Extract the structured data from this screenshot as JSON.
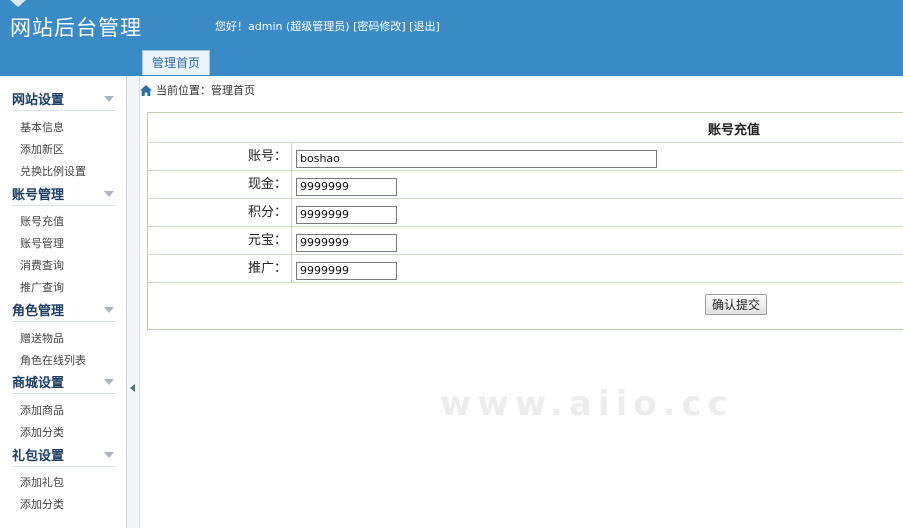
{
  "header": {
    "title": "网站后台管理",
    "greeting": "您好！",
    "username": "admin",
    "role": "(超级管理员)",
    "change_password": "[密码修改]",
    "logout": "[退出]"
  },
  "tabs": [
    {
      "label": "管理首页"
    }
  ],
  "sidebar": {
    "groups": [
      {
        "title": "网站设置",
        "items": [
          "基本信息",
          "添加新区",
          "兑换比例设置"
        ]
      },
      {
        "title": "账号管理",
        "items": [
          "账号充值",
          "账号管理",
          "消费查询",
          "推广查询"
        ]
      },
      {
        "title": "角色管理",
        "items": [
          "赠送物品",
          "角色在线列表"
        ]
      },
      {
        "title": "商城设置",
        "items": [
          "添加商品",
          "添加分类"
        ]
      },
      {
        "title": "礼包设置",
        "items": [
          "添加礼包",
          "添加分类"
        ]
      }
    ]
  },
  "breadcrumb": {
    "text": "当前位置：管理首页"
  },
  "form": {
    "title": "账号充值",
    "fields": [
      {
        "label": "账号：",
        "value": "boshao"
      },
      {
        "label": "现金：",
        "value": "9999999"
      },
      {
        "label": "积分：",
        "value": "9999999"
      },
      {
        "label": "元宝：",
        "value": "9999999"
      },
      {
        "label": "推广：",
        "value": "9999999"
      }
    ],
    "submit_label": "确认提交"
  },
  "watermark": "www.aiio.cc",
  "colors": {
    "header_bg": "#3a8ac6",
    "form_border": "#b9d2a8"
  },
  "icons": {
    "breadcrumb": "home-icon",
    "group_toggle": "chevron-down-icon",
    "splitter": "arrow-left-icon"
  }
}
